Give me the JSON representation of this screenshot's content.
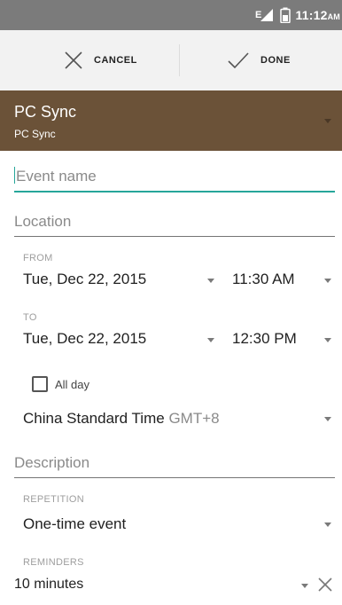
{
  "status_bar": {
    "time": "11:12",
    "ampm": "AM",
    "network_label": "E"
  },
  "actions": {
    "cancel_label": "CANCEL",
    "done_label": "DONE"
  },
  "calendar": {
    "name": "PC Sync",
    "account": "PC Sync",
    "header_color": "#6b5238"
  },
  "event": {
    "name_placeholder": "Event name",
    "location_placeholder": "Location",
    "from_label": "FROM",
    "from_date": "Tue, Dec 22, 2015",
    "from_time": "11:30 AM",
    "to_label": "TO",
    "to_date": "Tue, Dec 22, 2015",
    "to_time": "12:30 PM",
    "all_day_label": "All day",
    "all_day_checked": false,
    "timezone": "China Standard Time",
    "timezone_offset": "GMT+8",
    "description_placeholder": "Description",
    "repetition_label": "REPETITION",
    "repetition_value": "One-time event",
    "reminders_label": "REMINDERS",
    "reminder_value": "10 minutes"
  },
  "colors": {
    "accent": "#26a69a",
    "status_bar": "#7b7b7b",
    "action_bar": "#f2f2f2"
  },
  "icons": [
    "signal-icon",
    "battery-icon",
    "close-icon",
    "check-icon",
    "dropdown-caret-icon",
    "remove-reminder-icon"
  ]
}
